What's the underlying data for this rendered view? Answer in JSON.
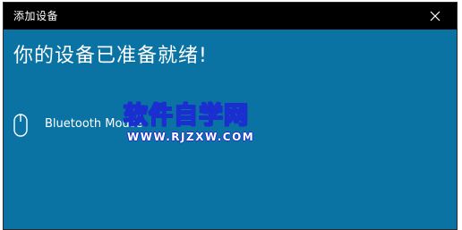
{
  "window": {
    "title": "添加设备",
    "close_icon": "close-icon"
  },
  "main": {
    "heading": "你的设备已准备就绪!",
    "device": {
      "icon": "mouse-icon",
      "name": "Bluetooth Mouse"
    }
  },
  "watermark": {
    "text": "软件自学网",
    "url": "WWW.RJZXW.COM"
  },
  "colors": {
    "background": "#0a73a3",
    "titlebar": "#000000",
    "text": "#ffffff",
    "watermark_outline": "#1b2fd0"
  }
}
